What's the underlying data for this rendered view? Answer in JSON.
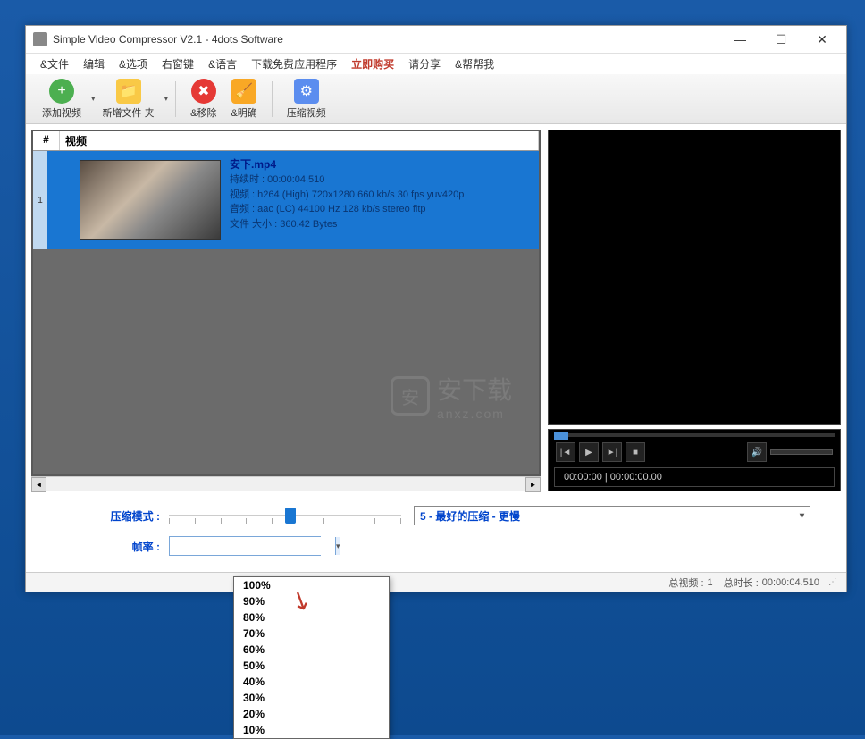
{
  "titlebar": {
    "text": "Simple Video Compressor V2.1 - 4dots Software"
  },
  "menu": {
    "file": "&文件",
    "edit": "编辑",
    "options": "&选项",
    "rightkey": "右窗键",
    "language": "&语言",
    "download": "下载免费应用程序",
    "buy": "立即购买",
    "share": "请分享",
    "help": "&帮帮我"
  },
  "toolbar": {
    "add_video": "添加视频",
    "new_folder": "新增文件 夹",
    "remove": "&移除",
    "clear": "&明确",
    "compress": "压缩视频"
  },
  "table": {
    "col_num": "#",
    "col_video": "视频",
    "row1_num": "1",
    "row1_name": "安下.mp4",
    "row1_duration": "持续时 : 00:00:04.510",
    "row1_video": "视频 : h264 (High) 720x1280 660 kb/s 30 fps yuv420p",
    "row1_audio": "音频 : aac (LC) 44100 Hz 128 kb/s stereo fltp",
    "row1_size": "文件 大小 : 360.42 Bytes"
  },
  "watermark": {
    "text": "安下载",
    "sub": "anxz.com"
  },
  "player": {
    "time": "00:00:00 | 00:00:00.00"
  },
  "controls": {
    "compress_mode_label": "压缩模式 :",
    "compress_mode_value": "5 - 最好的压缩 - 更慢",
    "fps_label": "帧率 :",
    "fps_value": ""
  },
  "fps_options": [
    "100%",
    "90%",
    "80%",
    "70%",
    "60%",
    "50%",
    "40%",
    "30%",
    "20%",
    "10%"
  ],
  "statusbar": {
    "total_videos_label": "总视频 :",
    "total_videos_value": "1",
    "total_duration_label": "总时长 :",
    "total_duration_value": "00:00:04.510"
  }
}
